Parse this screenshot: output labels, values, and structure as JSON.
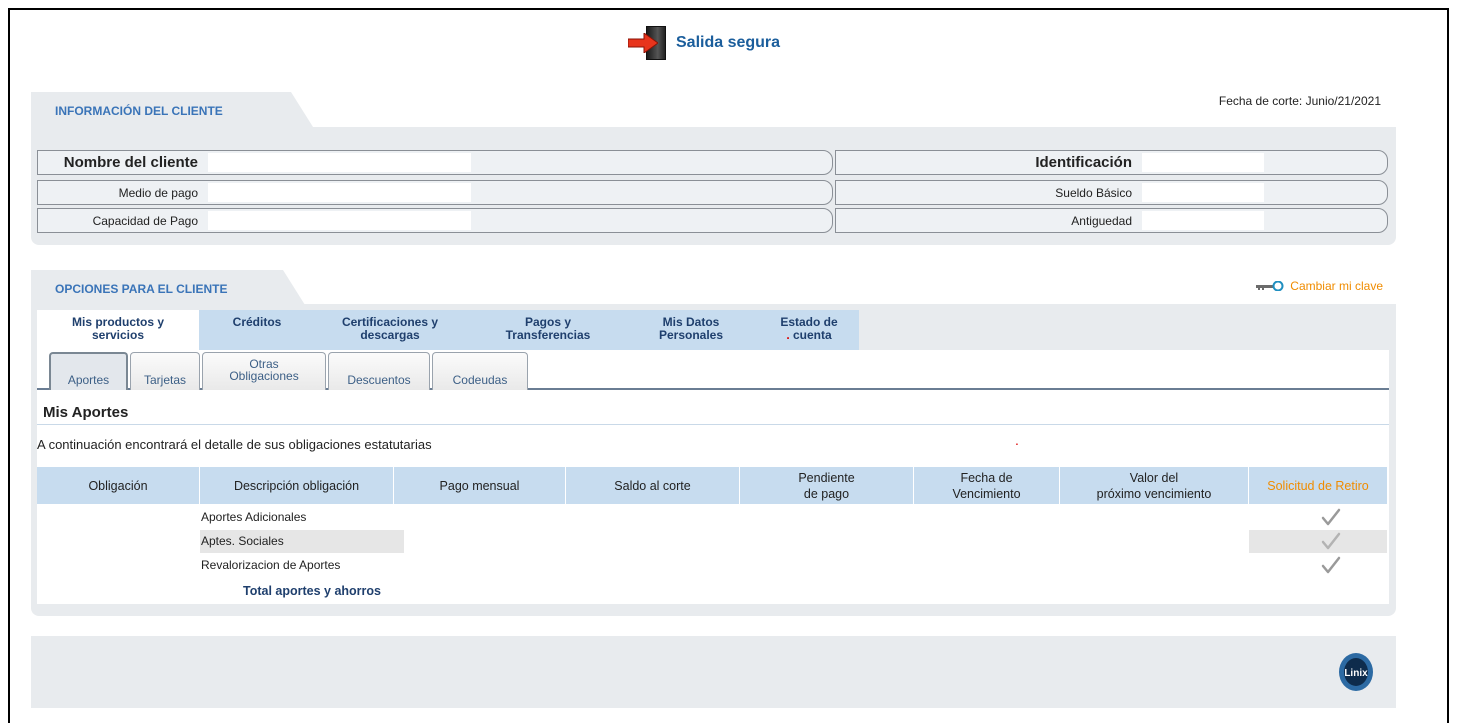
{
  "header": {
    "exit_label": "Salida segura"
  },
  "cliente": {
    "section_title": "INFORMACIÓN DEL CLIENTE",
    "fecha_label": "Fecha de corte:",
    "fecha_value": "Junio/21/2021",
    "left_fields": [
      "Nombre del cliente",
      "Medio de pago",
      "Capacidad de Pago"
    ],
    "right_fields": [
      "Identificación",
      "Sueldo Básico",
      "Antiguedad"
    ]
  },
  "opciones": {
    "section_title": "OPCIONES PARA EL CLIENTE",
    "cambiar_clave": "Cambiar mi clave",
    "main_tabs": [
      {
        "line1": "Mis productos y",
        "line2": "servicios"
      },
      {
        "line1": "Créditos",
        "line2": ""
      },
      {
        "line1": "Certificaciones y",
        "line2": "descargas"
      },
      {
        "line1": "Pagos y",
        "line2": "Transferencias"
      },
      {
        "line1": "Mis Datos",
        "line2": "Personales"
      },
      {
        "line1": "Estado de",
        "line2": "cuenta"
      }
    ],
    "sub_tabs": [
      {
        "line1": "",
        "line2": "Aportes"
      },
      {
        "line1": "",
        "line2": "Tarjetas"
      },
      {
        "line1": "Otras",
        "line2": "Obligaciones"
      },
      {
        "line1": "",
        "line2": "Descuentos"
      },
      {
        "line1": "",
        "line2": "Codeudas"
      }
    ]
  },
  "aportes": {
    "title": "Mis Aportes",
    "description": "A continuación encontrará el detalle de sus obligaciones estatutarias",
    "columns": [
      {
        "line1": "Obligación",
        "line2": ""
      },
      {
        "line1": "Descripción obligación",
        "line2": ""
      },
      {
        "line1": "Pago mensual",
        "line2": ""
      },
      {
        "line1": "Saldo al corte",
        "line2": ""
      },
      {
        "line1": "Pendiente",
        "line2": "de pago"
      },
      {
        "line1": "Fecha de",
        "line2": "Vencimiento"
      },
      {
        "line1": "Valor del",
        "line2": "próximo vencimiento"
      },
      {
        "line1": "Solicitud de Retiro",
        "line2": ""
      }
    ],
    "rows": [
      {
        "descripcion": "Aportes Adicionales"
      },
      {
        "descripcion": "Aptes. Sociales"
      },
      {
        "descripcion": "Revalorizacion de Aportes"
      }
    ],
    "total_label": "Total aportes y ahorros"
  },
  "colors": {
    "accent": "#3a74b8",
    "orange": "#f08c00",
    "tab_blue": "#c7dcef",
    "panel_gray": "#e8ebee"
  },
  "icons": {
    "exit": "exit-door-icon",
    "key": "key-icon",
    "check": "check-icon",
    "logo": "linix-logo"
  }
}
